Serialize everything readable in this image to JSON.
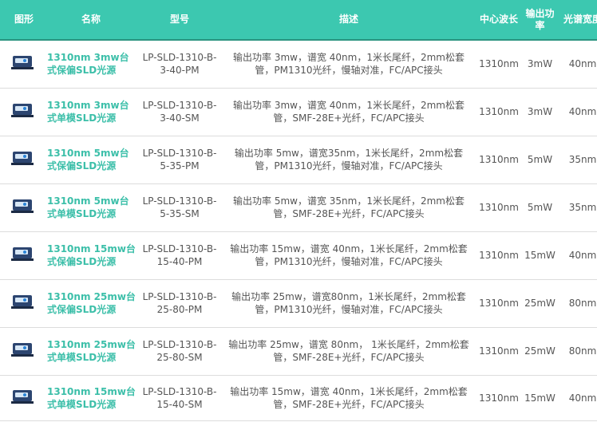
{
  "header": {
    "image": "图形",
    "name": "名称",
    "model": "型号",
    "description": "描述",
    "wavelength": "中心波长",
    "power": "输出功率",
    "bandwidth": "光谱宽度"
  },
  "rows": [
    {
      "icon": "sld-device-icon",
      "name": "1310nm 3mw台式保偏SLD光源",
      "model": "LP-SLD-1310-B-3-40-PM",
      "description": "输出功率 3mw，谱宽 40nm，1米长尾纤，2mm松套管，PM1310光纤，慢轴对准，FC/APC接头",
      "wavelength": "1310nm",
      "power": "3mW",
      "bandwidth": "40nm"
    },
    {
      "icon": "sld-device-icon",
      "name": "1310nm 3mw台式单模SLD光源",
      "model": "LP-SLD-1310-B-3-40-SM",
      "description": "输出功率 3mw，谱宽 40nm，1米长尾纤，2mm松套管，SMF-28E+光纤，FC/APC接头",
      "wavelength": "1310nm",
      "power": "3mW",
      "bandwidth": "40nm"
    },
    {
      "icon": "sld-device-icon",
      "name": "1310nm 5mw台式保偏SLD光源",
      "model": "LP-SLD-1310-B-5-35-PM",
      "description": "输出功率 5mw，谱宽35nm，1米长尾纤，2mm松套管，PM1310光纤，慢轴对准，FC/APC接头",
      "wavelength": "1310nm",
      "power": "5mW",
      "bandwidth": "35nm"
    },
    {
      "icon": "sld-device-icon",
      "name": "1310nm 5mw台式单模SLD光源",
      "model": "LP-SLD-1310-B-5-35-SM",
      "description": "输出功率 5mw，谱宽 35nm，1米长尾纤，2mm松套管，SMF-28E+光纤，FC/APC接头",
      "wavelength": "1310nm",
      "power": "5mW",
      "bandwidth": "35nm"
    },
    {
      "icon": "sld-device-icon",
      "name": "1310nm 15mw台式保偏SLD光源",
      "model": "LP-SLD-1310-B-15-40-PM",
      "description": "输出功率 15mw，谱宽 40nm，1米长尾纤，2mm松套管，PM1310光纤，慢轴对准，FC/APC接头",
      "wavelength": "1310nm",
      "power": "15mW",
      "bandwidth": "40nm"
    },
    {
      "icon": "sld-device-icon",
      "name": "1310nm 25mw台式保偏SLD光源",
      "model": "LP-SLD-1310-B-25-80-PM",
      "description": "输出功率 25mw，谱宽80nm，1米长尾纤，2mm松套管，PM1310光纤，慢轴对准，FC/APC接头",
      "wavelength": "1310nm",
      "power": "25mW",
      "bandwidth": "80nm"
    },
    {
      "icon": "sld-device-icon",
      "name": "1310nm 25mw台式单模SLD光源",
      "model": "LP-SLD-1310-B-25-80-SM",
      "description": "输出功率 25mw，谱宽 80nm， 1米长尾纤，2mm松套管，SMF-28E+光纤，FC/APC接头",
      "wavelength": "1310nm",
      "power": "25mW",
      "bandwidth": "80nm"
    },
    {
      "icon": "sld-device-icon",
      "name": "1310nm 15mw台式单模SLD光源",
      "model": "LP-SLD-1310-B-15-40-SM",
      "description": "输出功率 15mw，谱宽 40nm，1米长尾纤，2mm松套管，SMF-28E+光纤，FC/APC接头",
      "wavelength": "1310nm",
      "power": "15mW",
      "bandwidth": "40nm"
    }
  ]
}
